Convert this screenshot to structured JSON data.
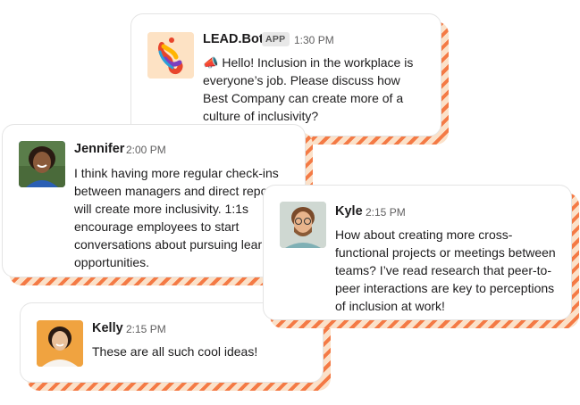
{
  "messages": {
    "bot": {
      "name": "LEAD.Bot",
      "badge": "APP",
      "time": "1:30 PM",
      "emoji": "📣",
      "text": "Hello! Inclusion in the workplace is everyone’s job. Please discuss how Best Company can create more of a culture of inclusivity?"
    },
    "jennifer": {
      "name": "Jennifer",
      "time": "2:00 PM",
      "text": "I think having more regular check-ins between managers and direct reports will create more inclusivity. 1:1s encourage employees to start conversations about pursuing learning opportunities."
    },
    "kyle": {
      "name": "Kyle",
      "time": "2:15 PM",
      "text": "How about creating more cross-functional projects or meetings between teams? I’ve read research that peer-to-peer interactions are key to perceptions of inclusion at work!"
    },
    "kelly": {
      "name": "Kelly",
      "time": "2:15 PM",
      "text": "These are all such cool ideas!"
    }
  },
  "colors": {
    "stripe": "#f47a45",
    "stripe_light": "#fbe1c9"
  }
}
